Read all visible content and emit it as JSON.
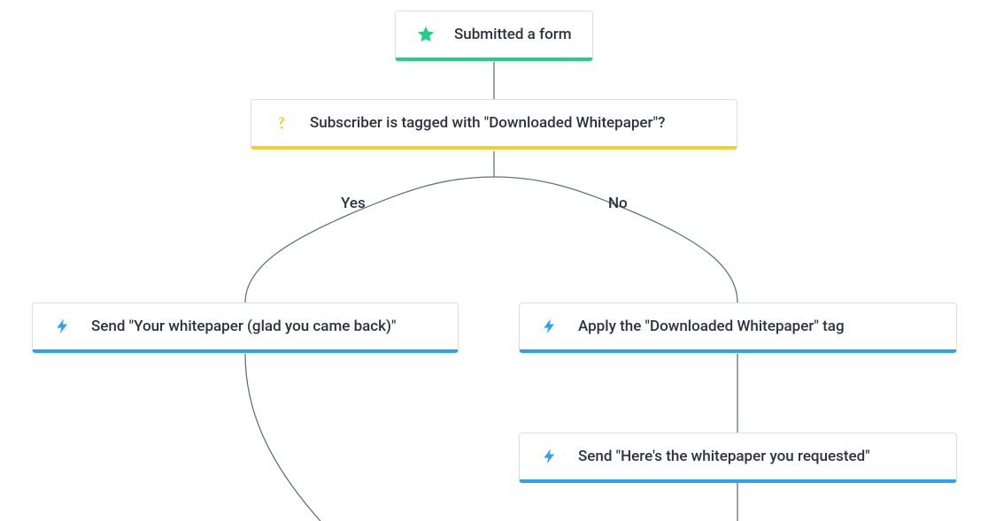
{
  "trigger": {
    "icon": "star",
    "label": "Submitted a form"
  },
  "condition": {
    "icon": "question",
    "label": "Subscriber is tagged with \"Downloaded Whitepaper\"?"
  },
  "branches": {
    "yes_label": "Yes",
    "no_label": "No"
  },
  "yes": {
    "actions": [
      {
        "icon": "bolt",
        "label": "Send \"Your whitepaper (glad you came back)\""
      }
    ]
  },
  "no": {
    "actions": [
      {
        "icon": "bolt",
        "label": "Apply the \"Downloaded Whitepaper\" tag"
      },
      {
        "icon": "bolt",
        "label": "Send \"Here's the whitepaper you requested\""
      }
    ]
  },
  "colors": {
    "trigger_accent": "#23cf84",
    "condition_accent": "#f4ce2a",
    "action_accent": "#2aa3f0",
    "connector": "#66707d"
  }
}
